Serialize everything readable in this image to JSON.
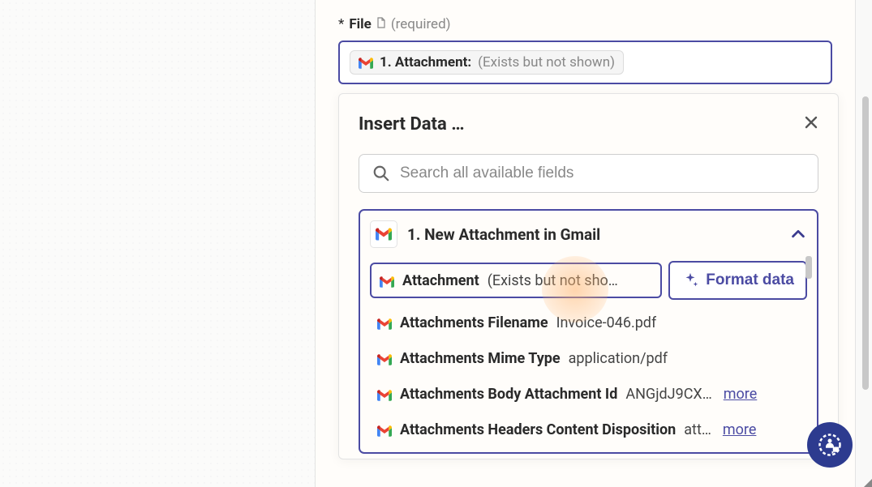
{
  "field": {
    "asterisk": "*",
    "name": "File",
    "required": "(required)"
  },
  "selected_pill": {
    "prefix": "1. Attachment:",
    "hint": "(Exists but not shown)"
  },
  "popover": {
    "title": "Insert Data …",
    "search_placeholder": "Search all available fields",
    "group_title": "1. New Attachment in Gmail",
    "format_btn": "Format data",
    "more": "more",
    "options": [
      {
        "label": "Attachment",
        "value": "(Exists but not sho…",
        "selected": true
      },
      {
        "label": "Attachments Filename",
        "value": "Invoice-046.pdf"
      },
      {
        "label": "Attachments Mime Type",
        "value": "application/pdf"
      },
      {
        "label": "Attachments Body Attachment Id",
        "value": "ANGjdJ9CX…",
        "has_more": true
      },
      {
        "label": "Attachments Headers Content Disposition",
        "value": "att…",
        "has_more": true
      }
    ]
  },
  "icons": {
    "gmail": "gmail-icon",
    "search": "search-icon",
    "close": "close-icon",
    "chevron": "chevron-up-icon",
    "sparkle": "sparkle-icon",
    "help": "help-icon"
  }
}
